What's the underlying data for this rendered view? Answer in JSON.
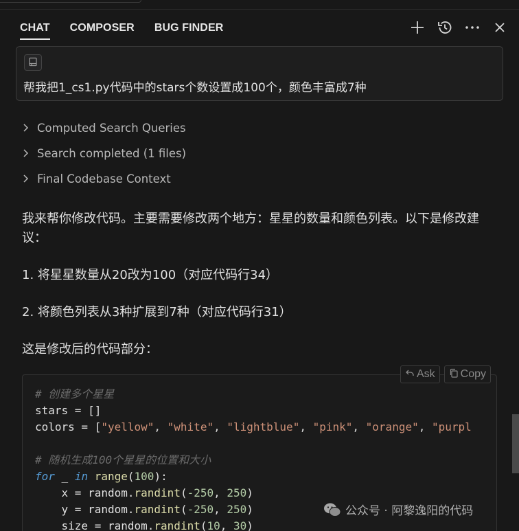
{
  "tabs": {
    "chat": "CHAT",
    "composer": "COMPOSER",
    "bug_finder": "BUG FINDER"
  },
  "header_actions": [
    "plus-icon",
    "history-icon",
    "more-icon",
    "close-icon"
  ],
  "query": {
    "text": "帮我把1_cs1.py代码中的stars个数设置成100个，颜色丰富成7种"
  },
  "steps": [
    "Computed Search Queries",
    "Search completed (1 files)",
    "Final Codebase Context"
  ],
  "answer": {
    "intro": "我来帮你修改代码。主要需要修改两个地方：星星的数量和颜色列表。以下是修改建议：",
    "point1": "1. 将星星数量从20改为100（对应代码行34）",
    "point2": "2. 将颜色列表从3种扩展到7种（对应代码行31）",
    "outro": "这是修改后的代码部分："
  },
  "code_block": {
    "ask_label": "Ask",
    "copy_label": "Copy",
    "comment1": "# 创建多个星星",
    "line_stars": "stars = []",
    "colors_prefix": "colors = [",
    "colors": [
      "\"yellow\"",
      "\"white\"",
      "\"lightblue\"",
      "\"pink\"",
      "\"orange\"",
      "\"purpl"
    ],
    "comment2": "# 随机生成100个星星的位置和大小",
    "for_kw": "for",
    "for_var": " _ ",
    "in_kw": "in",
    "range_fn": "range",
    "range_arg": "100",
    "x_var": "x",
    "y_var": "y",
    "size_var": "size",
    "random_obj": "random",
    "randint": "randint",
    "x_args": [
      "-250",
      "250"
    ],
    "y_args": [
      "-250",
      "250"
    ],
    "size_args": [
      "10",
      "30"
    ]
  },
  "watermark": {
    "text": "公众号 · 阿黎逸阳的代码"
  }
}
